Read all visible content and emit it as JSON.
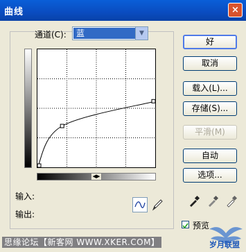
{
  "window": {
    "title": "曲线",
    "close_label": "×"
  },
  "channel": {
    "label": "通道(C):",
    "value": "蓝"
  },
  "buttons": {
    "ok": "好",
    "cancel": "取消",
    "load": "载入(L)...",
    "save": "存储(S)...",
    "smooth": "平滑(M)",
    "auto": "自动",
    "options": "选项..."
  },
  "readout": {
    "input_label": "输入:",
    "output_label": "输出:"
  },
  "preview": {
    "label": "预览",
    "checked": true
  },
  "watermark": {
    "left_text": "思缘论坛【新客网 WWW.XKER.COM】",
    "right_text": "岁月联盟"
  },
  "curve": {
    "points": [
      [
        0,
        0
      ],
      [
        0.21,
        0.35
      ],
      [
        1,
        0.56
      ]
    ],
    "color": "#000000"
  },
  "colors": {
    "titlebar": "#0a4cc0",
    "select_highlight": "#316ac5",
    "close_button": "#d9532d"
  }
}
